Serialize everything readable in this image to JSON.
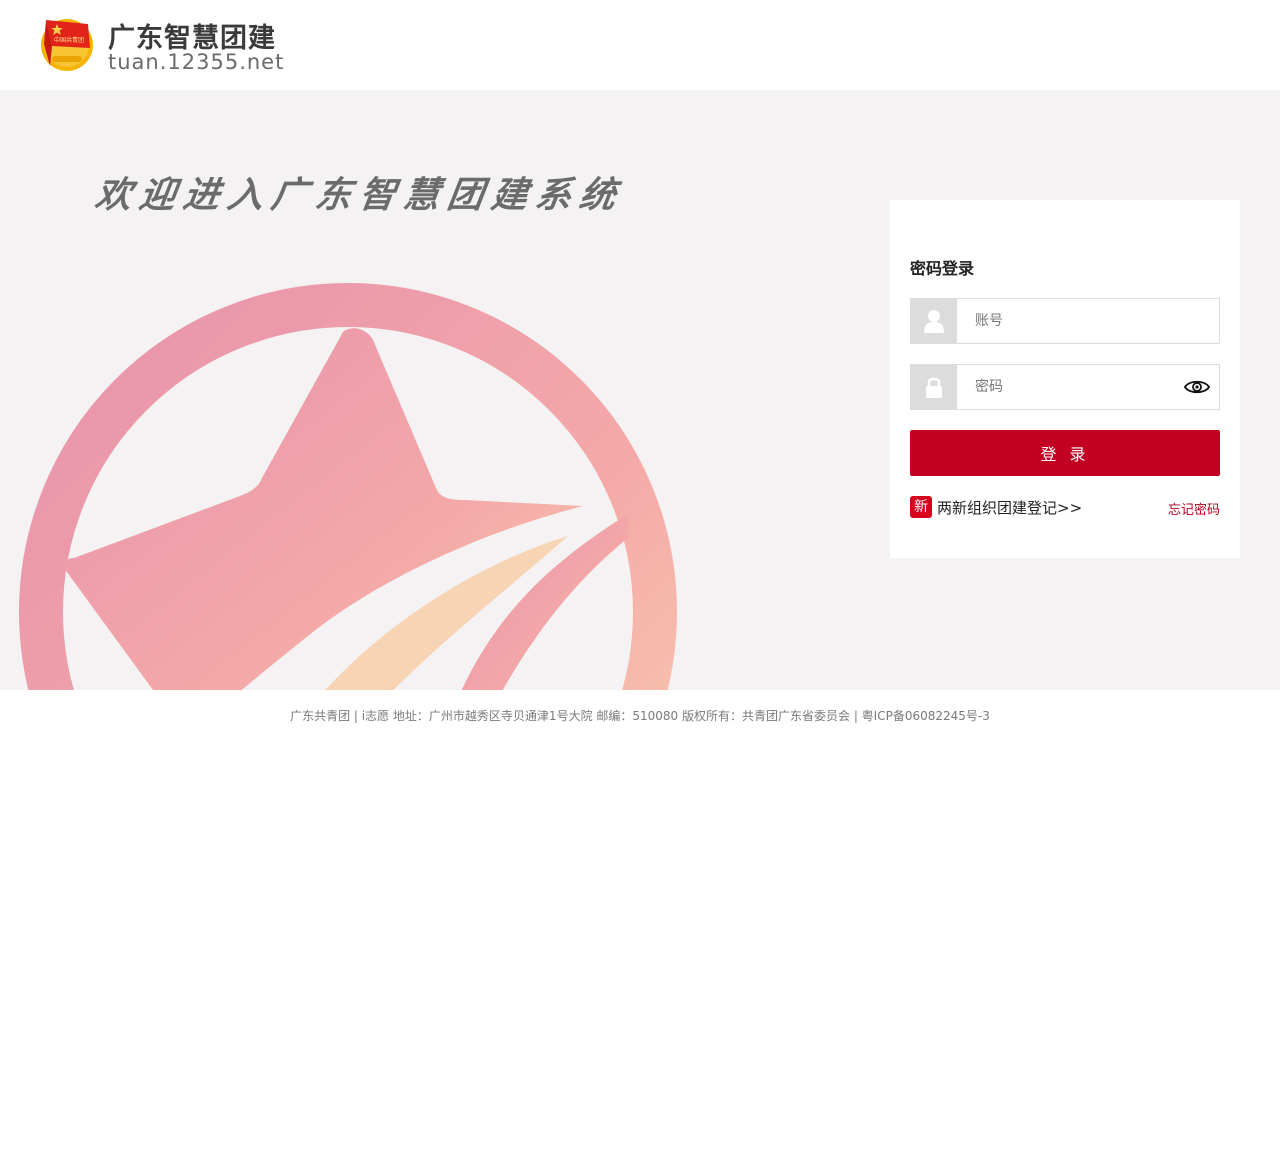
{
  "header": {
    "logo_title": "广东智慧团建",
    "logo_subtitle": "tuan.12355.net",
    "emblem_text": "中国共青团"
  },
  "banner": {
    "welcome_text": "欢迎进入广东智慧团建系统"
  },
  "login": {
    "title": "密码登录",
    "account_placeholder": "账号",
    "password_placeholder": "密码",
    "submit_label": "登 录",
    "new_badge": "新",
    "register_link": "两新组织团建登记>>",
    "forgot_link": "忘记密码"
  },
  "footer": {
    "text": "广东共青团 | i志愿 地址：广州市越秀区寺贝通津1号大院 邮编：510080  版权所有：共青团广东省委员会  |  粤ICP备06082245号-3"
  },
  "colors": {
    "brand_red": "#c20022",
    "banner_bg": "#f4f2f2",
    "input_icon_bg": "#dcdcdc"
  },
  "icons": {
    "account": "user-icon",
    "password": "lock-icon",
    "toggle": "eye-icon"
  }
}
